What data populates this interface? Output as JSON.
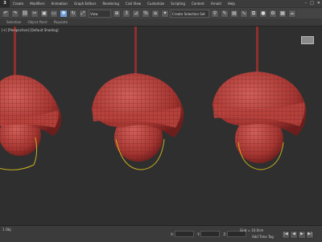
{
  "menu": {
    "logo": "3",
    "items": [
      "Create",
      "Modifiers",
      "Animation",
      "Graph Editors",
      "Rendering",
      "Civil View",
      "Customize",
      "Scripting",
      "Content",
      "Arnold",
      "Help"
    ]
  },
  "window_controls": {
    "minimize": "–",
    "maximize": "□",
    "close": "✕"
  },
  "toolbar": {
    "buttons": [
      "↶",
      "↷",
      "⛓",
      "✂",
      "▣",
      "▭",
      "✥",
      "↻",
      "⤢",
      "⊕",
      "⚲",
      "✎",
      "3",
      "⊿",
      "%",
      "≡",
      "✦"
    ],
    "active_index": 6,
    "view_select": "View",
    "selection_set": "Create Selection Set"
  },
  "ribbon": {
    "items": [
      "Selection",
      "Object Paint",
      "Populate"
    ]
  },
  "viewport": {
    "label": "[+] [Perspective] [Default Shading]",
    "lamp_color": "#b43c3a",
    "wire_color": "#c8b020"
  },
  "status": {
    "left_text": "1 Obj",
    "x_label": "X:",
    "y_label": "Y:",
    "z_label": "Z:",
    "grid_text": "Grid = 10.0cm",
    "time_tag": "Add Time Tag",
    "play_icons": [
      "|◀",
      "◀",
      "▶",
      "▶|"
    ]
  }
}
